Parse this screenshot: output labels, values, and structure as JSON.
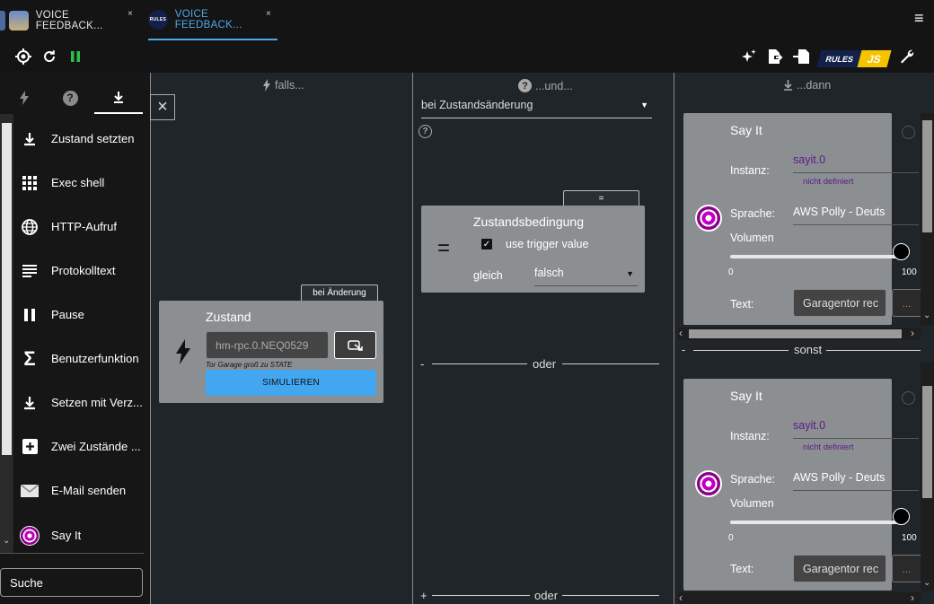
{
  "tabs": [
    {
      "label": "VOICE FEEDBACK...",
      "active": false
    },
    {
      "label": "VOICE FEEDBACK...",
      "active": true
    }
  ],
  "logo_text": {
    "rules": "RULES",
    "js": "JS"
  },
  "icons": {
    "close": "×",
    "menu": "≡"
  },
  "left_tabs": [
    "trigger-tab",
    "condition-tab",
    "action-tab"
  ],
  "left_items": [
    {
      "label": "Zustand setzten",
      "icon": "download-icon"
    },
    {
      "label": "Exec shell",
      "icon": "grid-icon"
    },
    {
      "label": "HTTP-Aufruf",
      "icon": "globe-icon"
    },
    {
      "label": "Protokolltext",
      "icon": "lines-icon"
    },
    {
      "label": "Pause",
      "icon": "pause-icon"
    },
    {
      "label": "Benutzerfunktion",
      "icon": "sigma-icon"
    },
    {
      "label": "Setzen mit Verz...",
      "icon": "download-icon"
    },
    {
      "label": "Zwei Zustände ...",
      "icon": "plus-box-icon"
    },
    {
      "label": "E-Mail senden",
      "icon": "mail-icon"
    },
    {
      "label": "Say It",
      "icon": "speaker-icon"
    }
  ],
  "search": {
    "value": "Suche"
  },
  "columns": {
    "trigger": {
      "title": "falls..."
    },
    "condition": {
      "title": "...und..."
    },
    "action": {
      "title": "...dann"
    }
  },
  "trigger_block": {
    "badge": "bei Änderung",
    "title": "Zustand",
    "object_id": "hm-rpc.0.NEQ0529",
    "caption": "Tor Garage groß zu STATE",
    "simulate": "SIMULIEREN"
  },
  "condition": {
    "mode": "bei Zustandsänderung",
    "badge": "=",
    "symbol": "=",
    "title": "Zustandsbedingung",
    "use_trigger_label": "use trigger value",
    "use_trigger_checked": true,
    "operator_label": "gleich",
    "value": "falsch",
    "or_label": "oder",
    "minus": "-",
    "plus": "+"
  },
  "actions": [
    {
      "title": "Say It",
      "instance_label": "Instanz:",
      "instance_value": "sayit.0",
      "instance_hint": "nicht definiert",
      "language_label": "Sprache:",
      "language_value": "AWS Polly - Deuts",
      "volume_label": "Volumen",
      "volume_min": "0",
      "volume_max": "100",
      "volume": 100,
      "text_label": "Text:",
      "text_value": "Garagentor rec",
      "more": "..."
    },
    {
      "title": "Say It",
      "instance_label": "Instanz:",
      "instance_value": "sayit.0",
      "instance_hint": "nicht definiert",
      "language_label": "Sprache:",
      "language_value": "AWS Polly - Deuts",
      "volume_label": "Volumen",
      "volume_min": "0",
      "volume_max": "100",
      "volume": 100,
      "text_label": "Text:",
      "text_value": "Garagentor rec",
      "more": "..."
    }
  ],
  "else_label": "sonst",
  "else_minus": "-",
  "colors": {
    "accent": "#4ea7e8",
    "simulate": "#43a6f0",
    "instance": "#5b1a8a",
    "logo_js": "#f5c400"
  }
}
